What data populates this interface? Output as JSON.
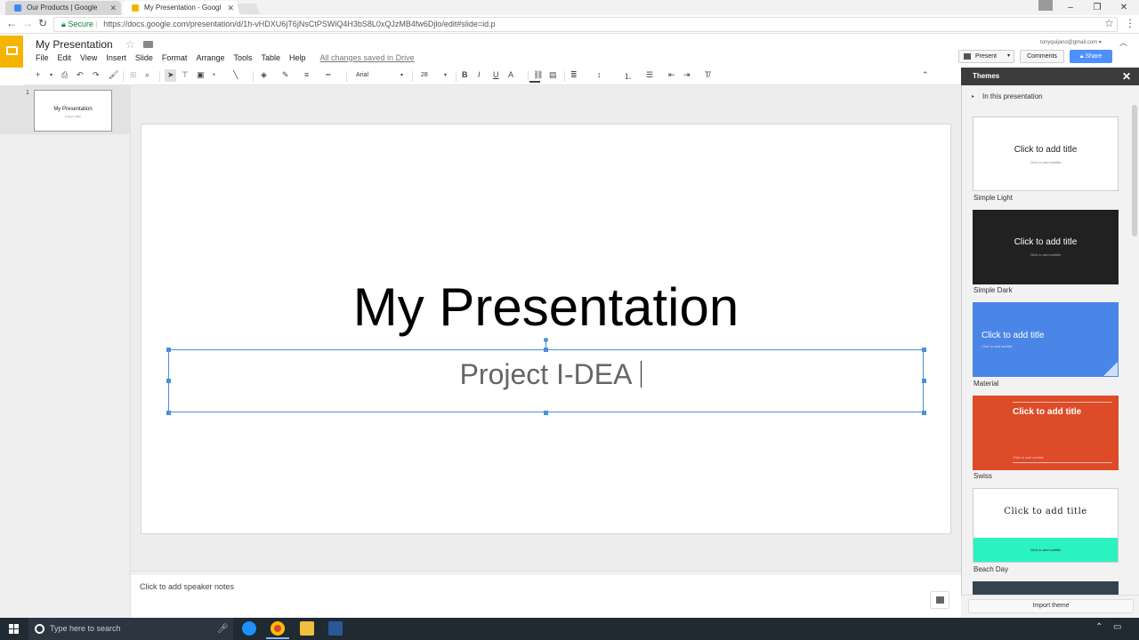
{
  "browser": {
    "tabs": [
      {
        "label": "Our Products | Google",
        "active": false
      },
      {
        "label": "My Presentation - Googl",
        "active": true
      }
    ],
    "secure_label": "Secure",
    "url": "https://docs.google.com/presentation/d/1h-vHDXU6jT6jNsCtPSWiQ4H3bS8L0xQJzMB4fw6Djlo/edit#slide=id.p"
  },
  "app": {
    "doc_title": "My Presentation",
    "account": "tonyquijano@gmail.com ▾",
    "menu": [
      "File",
      "Edit",
      "View",
      "Insert",
      "Slide",
      "Format",
      "Arrange",
      "Tools",
      "Table",
      "Help"
    ],
    "saved_status": "All changes saved in Drive",
    "present_label": "Present",
    "comments_label": "Comments",
    "share_label": "Share"
  },
  "toolbar": {
    "font": "Arial",
    "font_size": "28"
  },
  "filmstrip": {
    "slide_number": "1",
    "thumb_title": "My Presentation",
    "thumb_subtitle": "Project I-DEA"
  },
  "slide": {
    "title": "My Presentation",
    "subtitle": "Project I-DEA"
  },
  "notes": {
    "placeholder": "Click to add speaker notes"
  },
  "themes": {
    "heading": "Themes",
    "section": "In this presentation",
    "cards": [
      {
        "name": "Simple Light",
        "title": "Click to add title",
        "subtitle": "Click to add subtitle",
        "bg": "#ffffff",
        "fg": "#222222"
      },
      {
        "name": "Simple Dark",
        "title": "Click to add title",
        "subtitle": "Click to add subtitle",
        "bg": "#212121",
        "fg": "#ffffff"
      },
      {
        "name": "Material",
        "title": "Click to add title",
        "subtitle": "Click to add subtitle",
        "bg": "#4a85e8",
        "fg": "#ffffff"
      },
      {
        "name": "Swiss",
        "title": "Click to add title",
        "subtitle": "Click to add subtitle",
        "bg": "#dd4b28",
        "fg": "#ffffff"
      },
      {
        "name": "Beach Day",
        "title": "Click to add title",
        "subtitle": "Click to add subtitle",
        "bg": "#ffffff",
        "fg": "#222222"
      }
    ],
    "import_label": "Import theme"
  },
  "taskbar": {
    "search_placeholder": "Type here to search"
  },
  "colors": {
    "accent": "#4d90fe",
    "brand_slides": "#f4b400",
    "selection": "#4a90d9"
  }
}
